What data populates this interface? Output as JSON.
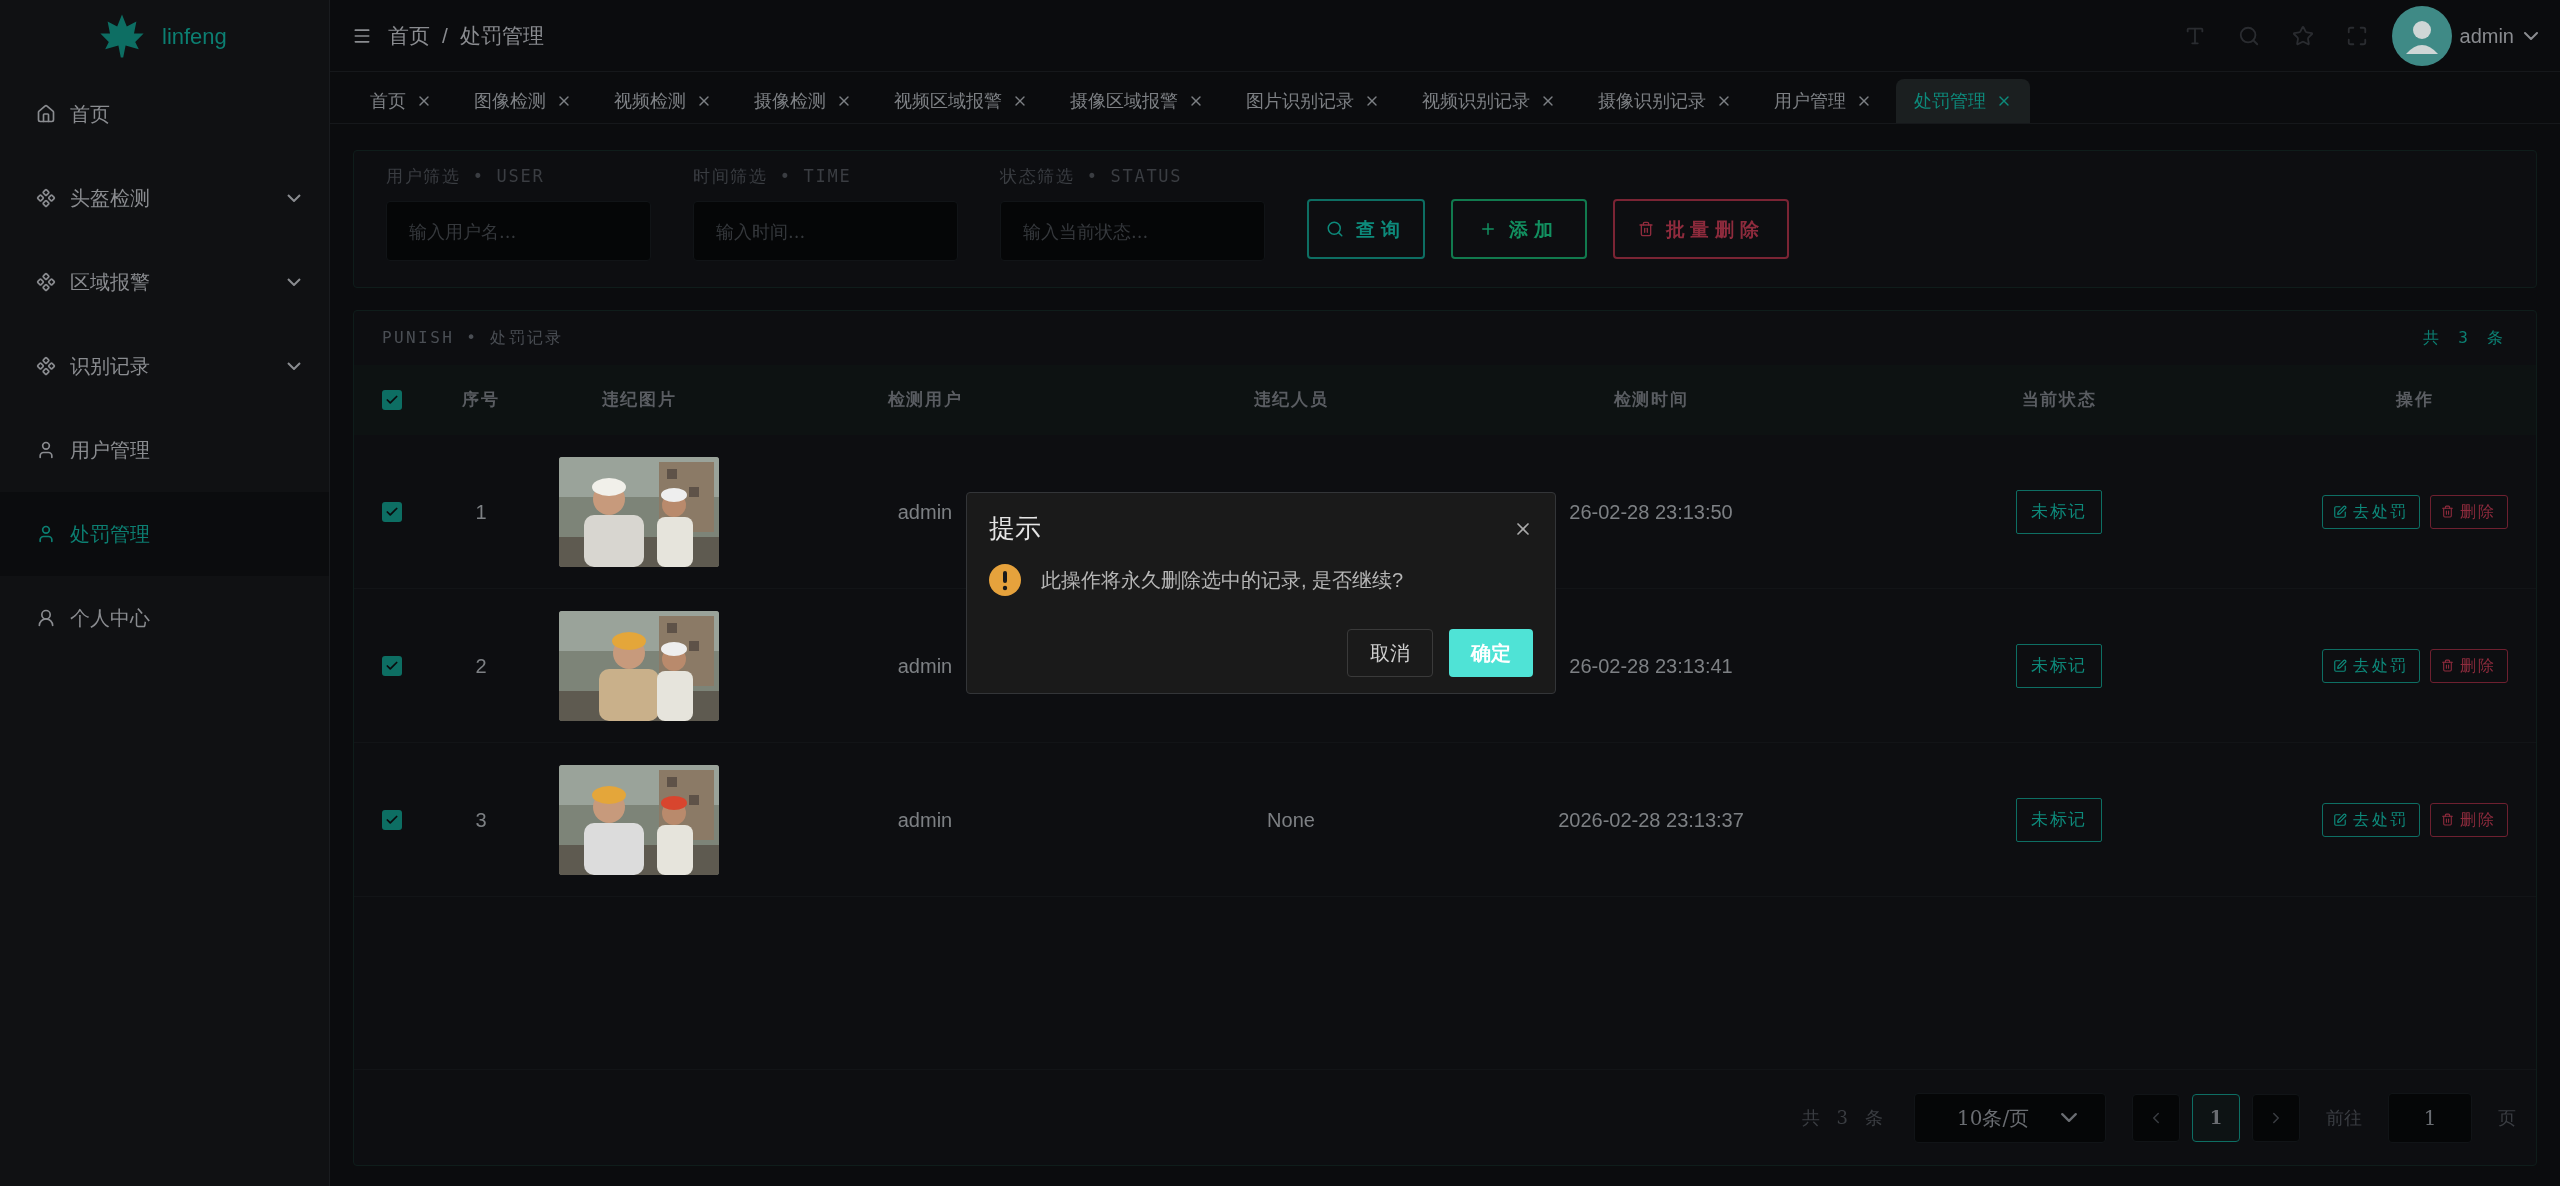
{
  "sidebar": {
    "logo": "linfeng",
    "items": [
      {
        "label": "首页",
        "kind": "home",
        "expandable": false,
        "selected": false
      },
      {
        "label": "头盔检测",
        "kind": "group",
        "expandable": true,
        "selected": false
      },
      {
        "label": "区域报警",
        "kind": "group",
        "expandable": true,
        "selected": false
      },
      {
        "label": "识别记录",
        "kind": "group",
        "expandable": true,
        "selected": false
      },
      {
        "label": "用户管理",
        "kind": "user",
        "expandable": false,
        "selected": false
      },
      {
        "label": "处罚管理",
        "kind": "user",
        "expandable": false,
        "selected": true
      },
      {
        "label": "个人中心",
        "kind": "profile",
        "expandable": false,
        "selected": false
      }
    ]
  },
  "header": {
    "breadcrumbs": [
      "首页",
      "处罚管理"
    ],
    "separator": "/",
    "user": "admin"
  },
  "tabs": [
    {
      "label": "首页",
      "selected": false
    },
    {
      "label": "图像检测",
      "selected": false
    },
    {
      "label": "视频检测",
      "selected": false
    },
    {
      "label": "摄像检测",
      "selected": false
    },
    {
      "label": "视频区域报警",
      "selected": false
    },
    {
      "label": "摄像区域报警",
      "selected": false
    },
    {
      "label": "图片识别记录",
      "selected": false
    },
    {
      "label": "视频识别记录",
      "selected": false
    },
    {
      "label": "摄像识别记录",
      "selected": false
    },
    {
      "label": "用户管理",
      "selected": false
    },
    {
      "label": "处罚管理",
      "selected": true
    }
  ],
  "filters": [
    {
      "label": "用户筛选 • USER",
      "placeholder": "输入用户名..."
    },
    {
      "label": "时间筛选 • TIME",
      "placeholder": "输入时间..."
    },
    {
      "label": "状态筛选 • STATUS",
      "placeholder": "输入当前状态..."
    }
  ],
  "actions": [
    {
      "kind": "search",
      "label": "查询"
    },
    {
      "kind": "add",
      "label": "添加"
    },
    {
      "kind": "delete",
      "label": "批量删除"
    }
  ],
  "table": {
    "title": "PUNISH • 处罚记录",
    "count": "共 3 条",
    "all_checked": true,
    "columns": [
      "序号",
      "违纪图片",
      "检测用户",
      "违纪人员",
      "检测时间",
      "当前状态",
      "操作"
    ],
    "rows": [
      {
        "checked": true,
        "index": "1",
        "user": "admin",
        "time": "26-02-28 23:13:50",
        "status": "未标记",
        "punish": "去处罚",
        "delete": "删除"
      },
      {
        "checked": true,
        "index": "2",
        "user": "admin",
        "time": "26-02-28 23:13:41",
        "status": "未标记",
        "punish": "去处罚",
        "delete": "删除"
      },
      {
        "checked": true,
        "index": "3",
        "user": "admin",
        "person": "None",
        "time": "2026-02-28 23:13:37",
        "status": "未标记",
        "punish": "去处罚",
        "delete": "删除"
      }
    ]
  },
  "pagination": {
    "total": "共 3 条",
    "page_size": "10条/页",
    "pages": [
      {
        "label": "1",
        "selected": true
      }
    ],
    "goto_label": "前往",
    "goto_value": "1",
    "suffix": "页"
  },
  "dialog": {
    "title": "提示",
    "message": "此操作将永久删除选中的记录, 是否继续?",
    "cancel": "取消",
    "confirm": "确定"
  }
}
